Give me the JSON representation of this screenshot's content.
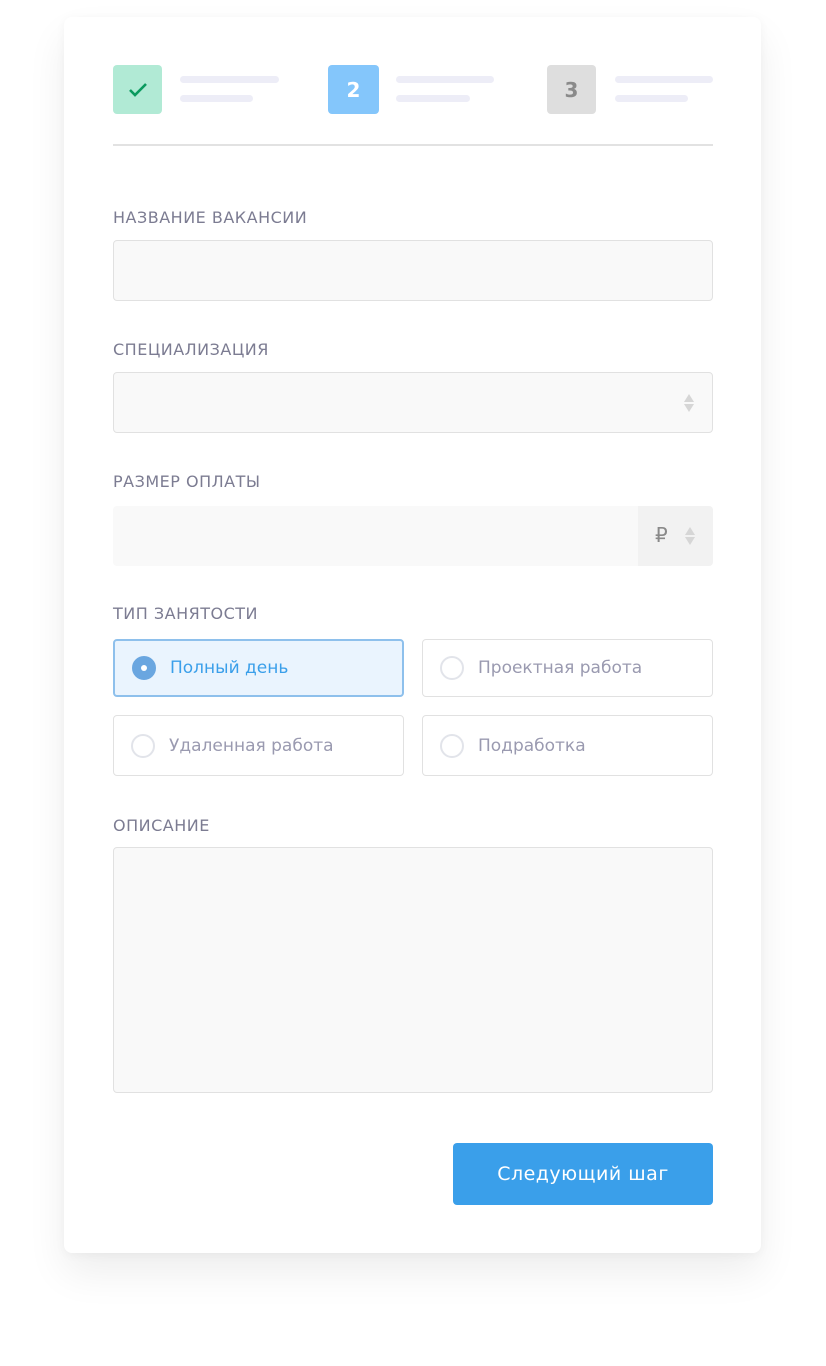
{
  "steps": [
    {
      "state": "done",
      "icon": "check-icon",
      "color": "#b1ead5",
      "icon_color": "#0a9a5e"
    },
    {
      "state": "current",
      "number": "2",
      "color": "#84c6fb"
    },
    {
      "state": "upcoming",
      "number": "3",
      "color": "#dedede"
    }
  ],
  "form": {
    "title_label": "НАЗВАНИЕ ВАКАНСИИ",
    "title_value": "",
    "spec_label": "СПЕЦИАЛИЗАЦИЯ",
    "spec_value": "",
    "salary_label": "РАЗМЕР ОПЛАТЫ",
    "salary_value": "",
    "currency": "₽",
    "employment_label": "ТИП ЗАНЯТОСТИ",
    "employment_options": [
      {
        "label": "Полный день",
        "selected": true
      },
      {
        "label": "Проектная работа",
        "selected": false
      },
      {
        "label": "Удаленная работа",
        "selected": false
      },
      {
        "label": "Подработка",
        "selected": false
      }
    ],
    "description_label": "ОПИСАНИЕ",
    "description_value": "",
    "next_button": "Следующий шаг"
  },
  "colors": {
    "accent": "#3a9fea"
  }
}
